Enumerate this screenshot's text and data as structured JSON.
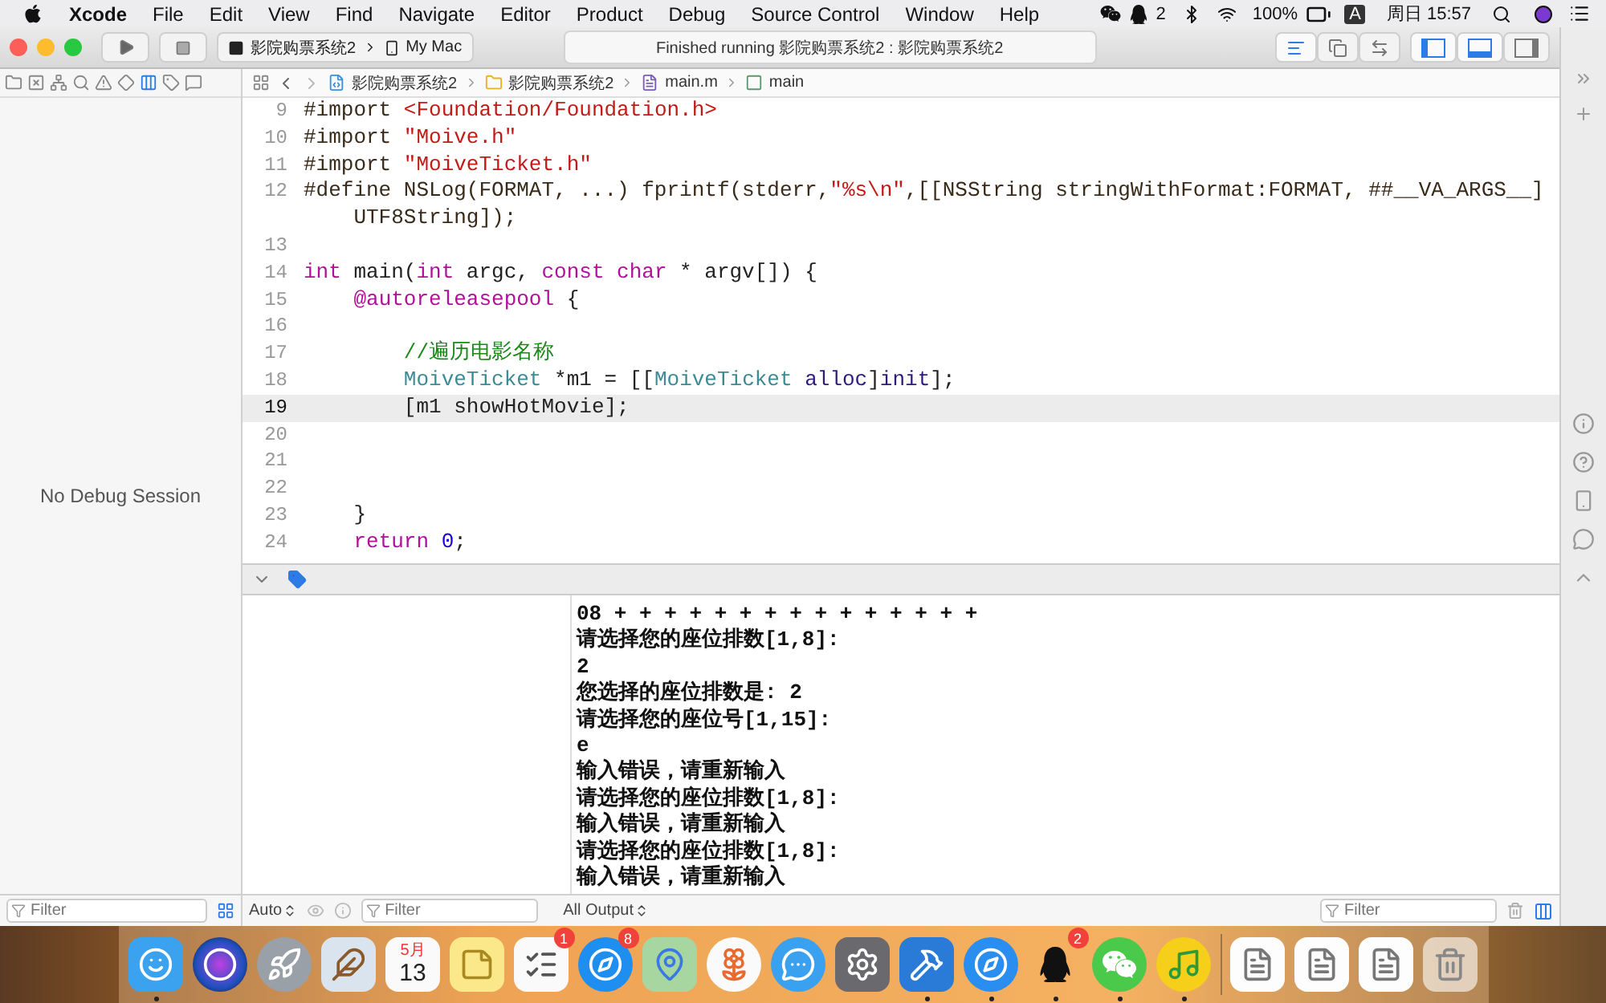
{
  "menu_bar": {
    "app": "Xcode",
    "menus": [
      "File",
      "Edit",
      "View",
      "Find",
      "Navigate",
      "Editor",
      "Product",
      "Debug",
      "Source Control",
      "Window",
      "Help"
    ],
    "qq_badge": "2",
    "battery": "100%",
    "input_source": "A",
    "clock": "周日 15:57"
  },
  "toolbar": {
    "scheme": "影院购票系统2",
    "destination": "My Mac",
    "activity": "Finished running 影院购票系统2 : 影院购票系统2",
    "editor_modes": [
      {
        "kind": "standard",
        "selected": true
      },
      {
        "kind": "assistant",
        "selected": false
      },
      {
        "kind": "version",
        "selected": false
      }
    ],
    "panels": [
      {
        "kind": "left",
        "on": true
      },
      {
        "kind": "bottom",
        "on": true
      },
      {
        "kind": "right",
        "on": false
      }
    ]
  },
  "navigator_tabs": [
    {
      "kind": "project",
      "selected": false
    },
    {
      "kind": "source-control",
      "selected": false
    },
    {
      "kind": "symbol",
      "selected": false
    },
    {
      "kind": "find",
      "selected": false
    },
    {
      "kind": "issue",
      "selected": false
    },
    {
      "kind": "test",
      "selected": false
    },
    {
      "kind": "debug",
      "selected": true
    },
    {
      "kind": "breakpoint",
      "selected": false
    },
    {
      "kind": "report",
      "selected": false
    }
  ],
  "jump_bar": [
    {
      "kind": "project",
      "label": "影院购票系统2"
    },
    {
      "kind": "folder",
      "label": "影院购票系统2"
    },
    {
      "kind": "file",
      "label": "main.m"
    },
    {
      "kind": "function",
      "label": "main"
    }
  ],
  "debug_navigator": {
    "message": "No Debug Session",
    "filter_placeholder": "Filter"
  },
  "editor": {
    "lines": [
      {
        "number": "9",
        "selected": false,
        "tokens": [
          {
            "kind": "preprocessor",
            "text": "#import "
          },
          {
            "kind": "string",
            "text": "<Foundation/Foundation.h>"
          }
        ]
      },
      {
        "number": "10",
        "selected": false,
        "tokens": [
          {
            "kind": "preprocessor",
            "text": "#import "
          },
          {
            "kind": "string",
            "text": "\"Moive.h\""
          }
        ]
      },
      {
        "number": "11",
        "selected": false,
        "tokens": [
          {
            "kind": "preprocessor",
            "text": "#import "
          },
          {
            "kind": "string",
            "text": "\"MoiveTicket.h\""
          }
        ]
      },
      {
        "number": "12",
        "selected": false,
        "tokens": [
          {
            "kind": "preprocessor",
            "text": "#define NSLog(FORMAT, ...) fprintf(stderr,"
          },
          {
            "kind": "string",
            "text": "\"%s\\n\""
          },
          {
            "kind": "preprocessor",
            "text": ",[[NSString stringWithFormat:FORMAT, ##__VA_ARGS__] UTF8String]);"
          }
        ]
      },
      {
        "number": "13",
        "selected": false
      },
      {
        "number": "14",
        "selected": false,
        "tokens": [
          {
            "kind": "keyword",
            "text": "int"
          },
          {
            "kind": "plain",
            "text": " main("
          },
          {
            "kind": "keyword",
            "text": "int"
          },
          {
            "kind": "plain",
            "text": " argc, "
          },
          {
            "kind": "keyword",
            "text": "const char"
          },
          {
            "kind": "plain",
            "text": " * argv[]) {"
          }
        ]
      },
      {
        "number": "15",
        "selected": false,
        "tokens": [
          {
            "kind": "keyword",
            "text": "    @autoreleasepool"
          },
          {
            "kind": "plain",
            "text": " {"
          }
        ]
      },
      {
        "number": "16",
        "selected": false
      },
      {
        "number": "17",
        "selected": false,
        "tokens": [
          {
            "kind": "comment",
            "text": "        //遍历电影名称"
          }
        ]
      },
      {
        "number": "18",
        "selected": false,
        "tokens": [
          {
            "kind": "type",
            "text": "        MoiveTicket"
          },
          {
            "kind": "plain",
            "text": " *m1 = [["
          },
          {
            "kind": "type",
            "text": "MoiveTicket"
          },
          {
            "kind": "method",
            "text": " alloc"
          },
          {
            "kind": "plain",
            "text": "]"
          },
          {
            "kind": "method",
            "text": "init"
          },
          {
            "kind": "plain",
            "text": "];"
          }
        ]
      },
      {
        "number": "19",
        "selected": true,
        "tokens": [
          {
            "kind": "plain",
            "text": "        [m1 showHotMovie];"
          }
        ]
      },
      {
        "number": "20",
        "selected": false
      },
      {
        "number": "21",
        "selected": false
      },
      {
        "number": "22",
        "selected": false
      },
      {
        "number": "23",
        "selected": false,
        "tokens": [
          {
            "kind": "plain",
            "text": "    }"
          }
        ]
      },
      {
        "number": "24",
        "selected": false,
        "tokens": [
          {
            "kind": "keyword",
            "text": "    return"
          },
          {
            "kind": "number",
            "text": " 0"
          },
          {
            "kind": "plain",
            "text": ";"
          }
        ]
      }
    ]
  },
  "debug_area": {
    "variables_scope": "Auto",
    "variables_filter_placeholder": "Filter",
    "output_scope": "All Output",
    "console_filter_placeholder": "Filter",
    "console_lines": [
      "08 + + + + + + + + + + + + + + +",
      "请选择您的座位排数[1,8]:",
      "2",
      "您选择的座位排数是: 2",
      "请选择您的座位号[1,15]:",
      "e",
      "输入错误，请重新输入",
      "请选择您的座位排数[1,8]:",
      "输入错误，请重新输入",
      "请选择您的座位排数[1,8]:",
      "输入错误，请重新输入"
    ]
  },
  "dock": [
    {
      "kind": "finder",
      "running": true
    },
    {
      "kind": "siri",
      "running": false
    },
    {
      "kind": "launchpad",
      "running": false
    },
    {
      "kind": "mail",
      "running": false
    },
    {
      "kind": "calendar",
      "running": false,
      "month": "5月",
      "day": "13"
    },
    {
      "kind": "notes",
      "running": false
    },
    {
      "kind": "reminders",
      "running": false,
      "badge": "1"
    },
    {
      "kind": "appstore",
      "running": false,
      "badge": "8"
    },
    {
      "kind": "maps",
      "running": false
    },
    {
      "kind": "photos",
      "running": false
    },
    {
      "kind": "messages",
      "running": false
    },
    {
      "kind": "settings",
      "running": false
    },
    {
      "kind": "xcode",
      "running": true
    },
    {
      "kind": "safari",
      "running": true
    },
    {
      "kind": "qq",
      "running": true,
      "badge": "2"
    },
    {
      "kind": "wechat",
      "running": true
    },
    {
      "kind": "music",
      "running": true
    },
    {
      "kind": "separator"
    },
    {
      "kind": "document",
      "running": false
    },
    {
      "kind": "document",
      "running": false
    },
    {
      "kind": "document",
      "running": false
    },
    {
      "kind": "trash",
      "running": false
    }
  ]
}
